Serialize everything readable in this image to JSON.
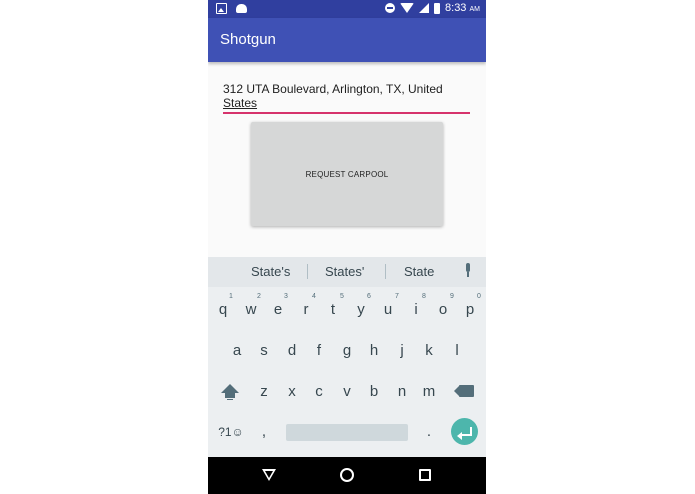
{
  "status_bar": {
    "time": "8:33",
    "ampm": "AM"
  },
  "app_bar": {
    "title": "Shotgun"
  },
  "form": {
    "address_line1": "312 UTA Boulevard, Arlington, TX, United",
    "address_line2": "States",
    "request_button": "REQUEST CARPOOL",
    "accent_color": "#d6336c"
  },
  "keyboard": {
    "suggestions": [
      "State's",
      "States'",
      "State"
    ],
    "row1": [
      "q",
      "w",
      "e",
      "r",
      "t",
      "y",
      "u",
      "i",
      "o",
      "p"
    ],
    "row1_hints": [
      "1",
      "2",
      "3",
      "4",
      "5",
      "6",
      "7",
      "8",
      "9",
      "0"
    ],
    "row2": [
      "a",
      "s",
      "d",
      "f",
      "g",
      "h",
      "j",
      "k",
      "l"
    ],
    "row3": [
      "z",
      "x",
      "c",
      "v",
      "b",
      "n",
      "m"
    ],
    "symbols_key": "?1☺",
    "comma_key": ",",
    "period_key": ".",
    "enter_color": "#4db6ac"
  },
  "colors": {
    "primary": "#3f51b5",
    "primary_dark": "#303f9f"
  }
}
